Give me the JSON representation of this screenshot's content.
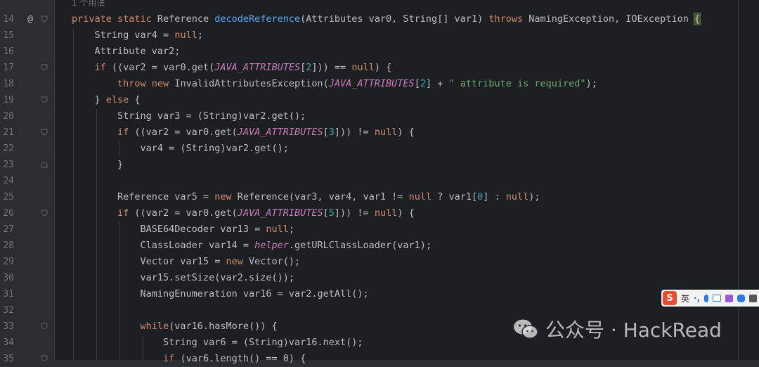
{
  "editor": {
    "usages_hint": "1 个用法",
    "gutter_marker": "@",
    "lines": [
      {
        "n": "14",
        "tokens": [
          [
            "kw",
            "private static "
          ],
          [
            "t",
            "Reference "
          ],
          [
            "fn",
            "decodeReference"
          ],
          [
            "t",
            "(Attributes var0, String[] var1) "
          ],
          [
            "kw",
            "throws "
          ],
          [
            "t",
            "NamingException, IOException "
          ],
          [
            "hb",
            "{"
          ]
        ]
      },
      {
        "n": "15",
        "tokens": [
          [
            "t",
            "    String var4 = "
          ],
          [
            "kw",
            "null"
          ],
          [
            "t",
            ";"
          ]
        ]
      },
      {
        "n": "16",
        "tokens": [
          [
            "t",
            "    Attribute var2;"
          ]
        ]
      },
      {
        "n": "17",
        "tokens": [
          [
            "kw",
            "    if "
          ],
          [
            "t",
            "((var2 = var0.get("
          ],
          [
            "cst",
            "JAVA_ATTRIBUTES"
          ],
          [
            "t",
            "["
          ],
          [
            "num",
            "2"
          ],
          [
            "t",
            "])) == "
          ],
          [
            "kw",
            "null"
          ],
          [
            "t",
            ") {"
          ]
        ]
      },
      {
        "n": "18",
        "tokens": [
          [
            "kw",
            "        throw new "
          ],
          [
            "t",
            "InvalidAttributesException("
          ],
          [
            "cst",
            "JAVA_ATTRIBUTES"
          ],
          [
            "t",
            "["
          ],
          [
            "num",
            "2"
          ],
          [
            "t",
            "] + "
          ],
          [
            "str",
            "\" attribute is required\""
          ],
          [
            "t",
            ");"
          ]
        ]
      },
      {
        "n": "19",
        "tokens": [
          [
            "t",
            "    } "
          ],
          [
            "kw",
            "else "
          ],
          [
            "t",
            "{"
          ]
        ]
      },
      {
        "n": "20",
        "tokens": [
          [
            "t",
            "        String var3 = (String)var2.get();"
          ]
        ]
      },
      {
        "n": "21",
        "tokens": [
          [
            "kw",
            "        if "
          ],
          [
            "t",
            "((var2 = var0.get("
          ],
          [
            "cst",
            "JAVA_ATTRIBUTES"
          ],
          [
            "t",
            "["
          ],
          [
            "num",
            "3"
          ],
          [
            "t",
            "])) != "
          ],
          [
            "kw",
            "null"
          ],
          [
            "t",
            ") {"
          ]
        ]
      },
      {
        "n": "22",
        "tokens": [
          [
            "t",
            "            var4 = (String)var2.get();"
          ]
        ]
      },
      {
        "n": "23",
        "tokens": [
          [
            "t",
            "        }"
          ]
        ]
      },
      {
        "n": "24",
        "tokens": []
      },
      {
        "n": "25",
        "tokens": [
          [
            "t",
            "        Reference var5 = "
          ],
          [
            "kw",
            "new "
          ],
          [
            "t",
            "Reference(var3, var4, var1 != "
          ],
          [
            "kw",
            "null "
          ],
          [
            "t",
            "? var1["
          ],
          [
            "num",
            "0"
          ],
          [
            "t",
            "] : "
          ],
          [
            "kw",
            "null"
          ],
          [
            "t",
            ");"
          ]
        ]
      },
      {
        "n": "26",
        "tokens": [
          [
            "kw",
            "        if "
          ],
          [
            "t",
            "((var2 = var0.get("
          ],
          [
            "cst",
            "JAVA_ATTRIBUTES"
          ],
          [
            "t",
            "["
          ],
          [
            "num",
            "5"
          ],
          [
            "t",
            "])) != "
          ],
          [
            "kw",
            "null"
          ],
          [
            "t",
            ") {"
          ]
        ]
      },
      {
        "n": "27",
        "tokens": [
          [
            "t",
            "            BASE64Decoder var13 = "
          ],
          [
            "kw",
            "null"
          ],
          [
            "t",
            ";"
          ]
        ]
      },
      {
        "n": "28",
        "tokens": [
          [
            "t",
            "            ClassLoader var14 = "
          ],
          [
            "cst",
            "helper"
          ],
          [
            "t",
            ".getURLClassLoader(var1);"
          ]
        ]
      },
      {
        "n": "29",
        "tokens": [
          [
            "t",
            "            Vector var15 = "
          ],
          [
            "kw",
            "new "
          ],
          [
            "t",
            "Vector();"
          ]
        ]
      },
      {
        "n": "30",
        "tokens": [
          [
            "t",
            "            var15.setSize(var2.size());"
          ]
        ]
      },
      {
        "n": "31",
        "tokens": [
          [
            "t",
            "            NamingEnumeration var16 = var2.getAll();"
          ]
        ]
      },
      {
        "n": "32",
        "tokens": []
      },
      {
        "n": "33",
        "tokens": [
          [
            "kw",
            "            while"
          ],
          [
            "t",
            "(var16.hasMore()) {"
          ]
        ]
      },
      {
        "n": "34",
        "tokens": [
          [
            "t",
            "                String var6 = (String)var16.next();"
          ]
        ]
      },
      {
        "n": "35",
        "tokens": [
          [
            "kw",
            "                if "
          ],
          [
            "t",
            "(var6.length() == 0) {"
          ]
        ]
      }
    ]
  },
  "ime_bar": {
    "logo": "S",
    "mode": "英",
    "punct": "·,"
  },
  "watermark": {
    "text": "公众号 · HackRead"
  },
  "colors": {
    "keyword": "#cf8e6d",
    "function": "#56a8f5",
    "constant": "#c77dbb",
    "number": "#2aacb8",
    "string": "#6aab73",
    "text": "#bcbec4"
  }
}
